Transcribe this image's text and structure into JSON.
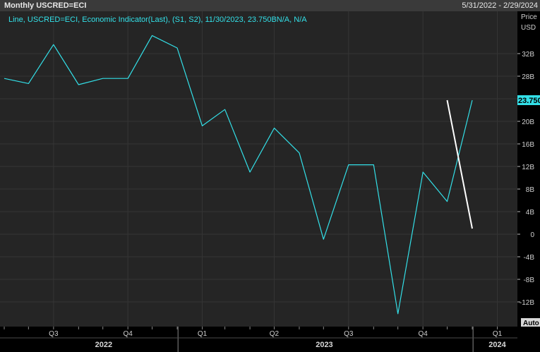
{
  "header": {
    "title": "Monthly USCRED=ECI",
    "date_range": "5/31/2022 - 2/29/2024"
  },
  "axis_panel": {
    "price_label": "Price",
    "currency_label": "USD",
    "auto_label": "Auto"
  },
  "legend_text": "Line, USCRED=ECI, Economic Indicator(Last), (S1, S2), 11/30/2023, 23.750BN/A, N/A",
  "last_value_label": "23.750",
  "colors": {
    "series": "#33e0e8",
    "projection": "#ffffff",
    "background": "#252525",
    "grid": "#353535"
  },
  "chart_data": {
    "type": "line",
    "x": [
      "2022-05-31",
      "2022-06-30",
      "2022-07-31",
      "2022-08-31",
      "2022-09-30",
      "2022-10-31",
      "2022-11-30",
      "2022-12-31",
      "2023-01-31",
      "2023-02-28",
      "2023-03-31",
      "2023-04-30",
      "2023-05-31",
      "2023-06-30",
      "2023-07-31",
      "2023-08-31",
      "2023-09-30",
      "2023-10-31",
      "2023-11-30",
      "2023-12-31"
    ],
    "series": [
      {
        "values": [
          27.6,
          26.7,
          33.6,
          26.5,
          27.6,
          27.6,
          35.2,
          33.0,
          19.2,
          22.1,
          11.0,
          18.8,
          14.4,
          -0.9,
          12.3,
          12.3,
          -14.1,
          11.0,
          5.8,
          23.75
        ]
      },
      {
        "values": [
          null,
          null,
          null,
          null,
          null,
          null,
          null,
          null,
          null,
          null,
          null,
          null,
          null,
          null,
          null,
          null,
          null,
          null,
          23.75,
          1.0
        ]
      }
    ],
    "y_ticks": [
      "32B",
      "28B",
      "24B",
      "20B",
      "16B",
      "12B",
      "8B",
      "4B",
      "0",
      "-4B",
      "-8B",
      "-12B"
    ],
    "y_tick_values": [
      32,
      28,
      24,
      20,
      16,
      12,
      8,
      4,
      0,
      -4,
      -8,
      -12
    ],
    "ylim": [
      -16,
      36
    ],
    "x_ticks": [
      "Q3",
      "Q4",
      "Q1",
      "Q2",
      "Q3",
      "Q4",
      "Q1"
    ],
    "x_tick_dates": [
      "2022-07-31",
      "2022-10-31",
      "2023-01-31",
      "2023-04-30",
      "2023-07-31",
      "2023-10-31",
      "2024-01-31"
    ],
    "year_labels": [
      "2022",
      "2023",
      "2024"
    ],
    "year_label_dates": [
      "2022-10-01",
      "2023-07-01",
      "2024-01-31"
    ],
    "grid": true
  }
}
